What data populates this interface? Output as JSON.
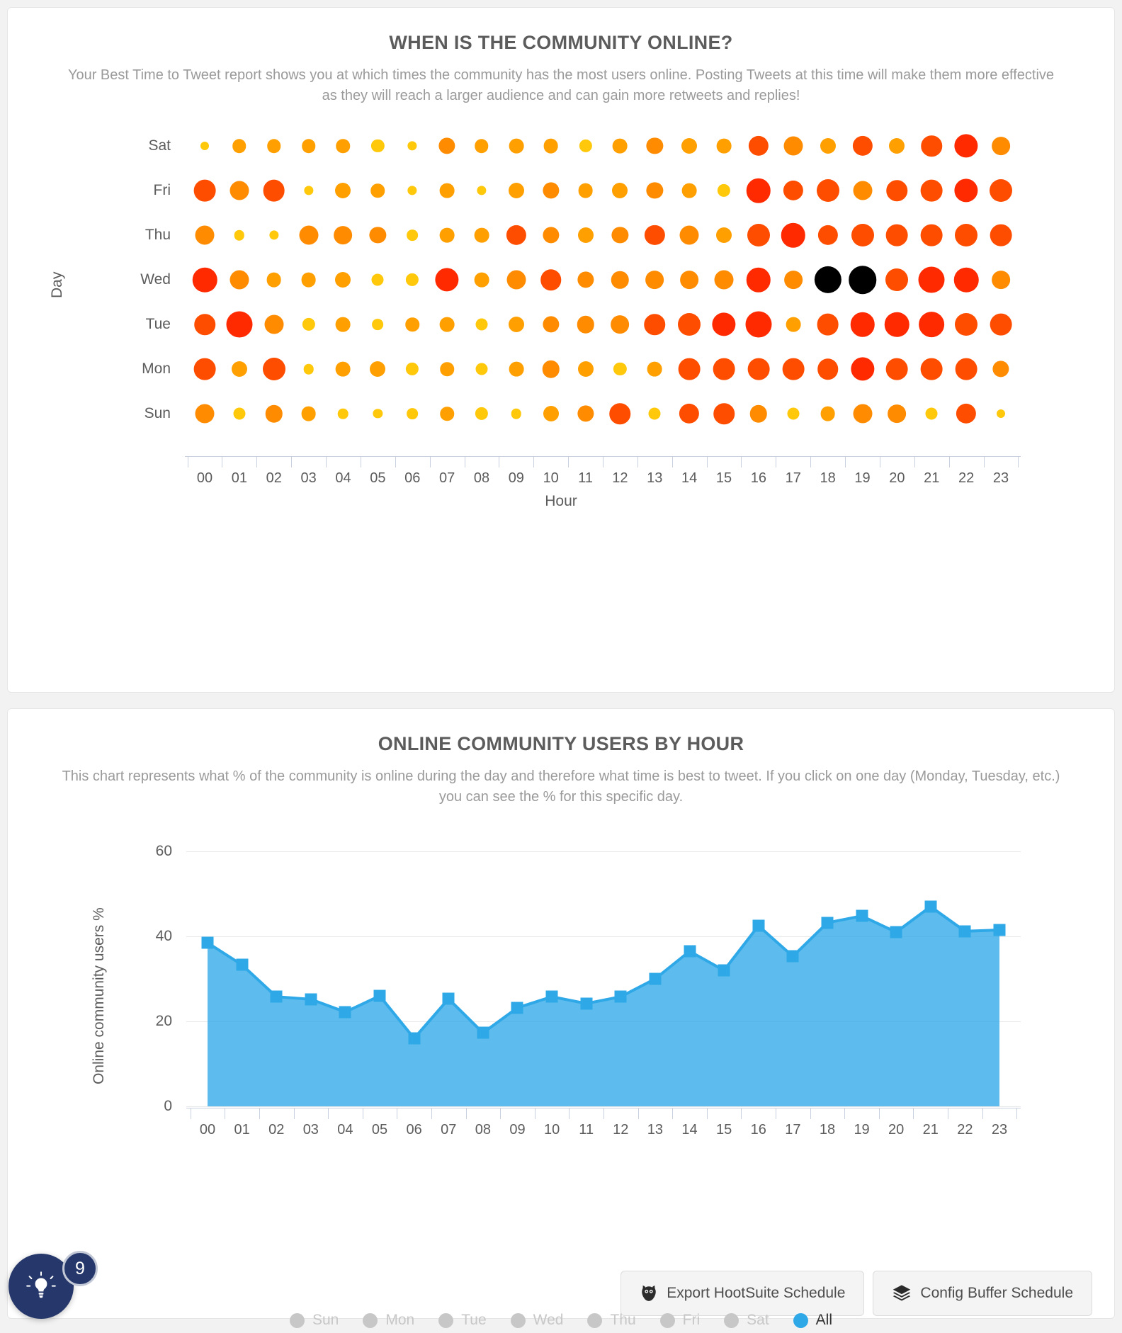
{
  "bubble_card": {
    "title": "WHEN IS THE COMMUNITY ONLINE?",
    "description": "Your Best Time to Tweet report shows you at which times the community has the most users online. Posting Tweets at this time will make them more effective as they will reach a larger audience and can gain more retweets and replies!",
    "buttons": [
      {
        "label": "Export HootSuite Schedule",
        "icon": "owl-icon"
      },
      {
        "label": "Config Buffer Schedule",
        "icon": "layers-icon"
      }
    ]
  },
  "area_card": {
    "title": "ONLINE COMMUNITY USERS BY HOUR",
    "description": "This chart represents what % of the community is online during the day and therefore what time is best to tweet. If you click on one day (Monday, Tuesday, etc.) you can see the % for this specific day."
  },
  "help_widget": {
    "count": "9",
    "icon": "lightbulb-icon"
  },
  "chart_data": [
    {
      "type": "heatmap",
      "title": "WHEN IS THE COMMUNITY ONLINE?",
      "xlabel": "Hour",
      "ylabel": "Day",
      "x": [
        "00",
        "01",
        "02",
        "03",
        "04",
        "05",
        "06",
        "07",
        "08",
        "09",
        "10",
        "11",
        "12",
        "13",
        "14",
        "15",
        "16",
        "17",
        "18",
        "19",
        "20",
        "21",
        "22",
        "23"
      ],
      "y": [
        "Sat",
        "Fri",
        "Thu",
        "Wed",
        "Tue",
        "Mon",
        "Sun"
      ],
      "legend": "bubble size and color encode number of community users online",
      "colors": {
        "low": "#ffc80a",
        "mid": "#ff8c00",
        "high": "#ff2a00",
        "peak": "#000000"
      },
      "rows": [
        {
          "day": "Sat",
          "values": [
            4,
            10,
            10,
            10,
            10,
            9,
            5,
            13,
            10,
            11,
            11,
            9,
            11,
            13,
            12,
            11,
            17,
            16,
            12,
            17,
            12,
            18,
            21,
            15
          ]
        },
        {
          "day": "Fri",
          "values": [
            19,
            16,
            19,
            5,
            12,
            10,
            5,
            11,
            5,
            12,
            13,
            11,
            12,
            13,
            11,
            9,
            22,
            17,
            20,
            16,
            18,
            19,
            21,
            20
          ]
        },
        {
          "day": "Thu",
          "values": [
            16,
            6,
            5,
            16,
            15,
            13,
            7,
            11,
            11,
            17,
            13,
            12,
            13,
            17,
            16,
            12,
            20,
            22,
            17,
            20,
            19,
            19,
            20,
            19
          ]
        },
        {
          "day": "Wed",
          "values": [
            22,
            16,
            11,
            11,
            12,
            8,
            9,
            21,
            11,
            16,
            18,
            13,
            14,
            15,
            15,
            16,
            22,
            15,
            25,
            26,
            20,
            24,
            22,
            15
          ]
        },
        {
          "day": "Tue",
          "values": [
            18,
            24,
            16,
            9,
            11,
            7,
            10,
            11,
            8,
            12,
            13,
            14,
            15,
            18,
            20,
            21,
            24,
            11,
            19,
            22,
            22,
            23,
            20,
            19
          ]
        },
        {
          "day": "Mon",
          "values": [
            19,
            12,
            20,
            6,
            11,
            12,
            9,
            10,
            8,
            11,
            14,
            12,
            9,
            11,
            19,
            19,
            19,
            19,
            18,
            21,
            19,
            19,
            19,
            13
          ]
        },
        {
          "day": "Sun",
          "values": [
            16,
            8,
            14,
            11,
            6,
            5,
            7,
            10,
            9,
            6,
            12,
            13,
            18,
            8,
            17,
            18,
            14,
            8,
            11,
            16,
            15,
            8,
            17,
            4
          ]
        }
      ],
      "peaks": [
        {
          "day": "Fri",
          "hour": "16"
        },
        {
          "day": "Wed",
          "hour": "19"
        }
      ]
    },
    {
      "type": "area",
      "title": "ONLINE COMMUNITY USERS BY HOUR",
      "xlabel": "",
      "ylabel": "Online community users %",
      "ylim": [
        0,
        60
      ],
      "yticks": [
        0,
        20,
        40,
        60
      ],
      "grid": true,
      "legend_position": "bottom",
      "categories": [
        "00",
        "01",
        "02",
        "03",
        "04",
        "05",
        "06",
        "07",
        "08",
        "09",
        "10",
        "11",
        "12",
        "13",
        "14",
        "15",
        "16",
        "17",
        "18",
        "19",
        "20",
        "21",
        "22",
        "23"
      ],
      "series": [
        {
          "name": "All",
          "color": "#2fa8e8",
          "active": true,
          "values": [
            38.5,
            33.3,
            25.8,
            25.2,
            22.2,
            26.0,
            16.0,
            25.3,
            17.3,
            23.2,
            25.8,
            24.2,
            25.8,
            30.0,
            36.5,
            32.0,
            42.5,
            35.3,
            43.2,
            44.8,
            41.0,
            47.0,
            41.2,
            41.5
          ]
        }
      ],
      "inactive_series": [
        {
          "name": "Sun",
          "color": "#c7c7c7"
        },
        {
          "name": "Mon",
          "color": "#c7c7c7"
        },
        {
          "name": "Tue",
          "color": "#c7c7c7"
        },
        {
          "name": "Wed",
          "color": "#c7c7c7"
        },
        {
          "name": "Thu",
          "color": "#c7c7c7"
        },
        {
          "name": "Fri",
          "color": "#c7c7c7"
        },
        {
          "name": "Sat",
          "color": "#c7c7c7"
        }
      ]
    }
  ]
}
